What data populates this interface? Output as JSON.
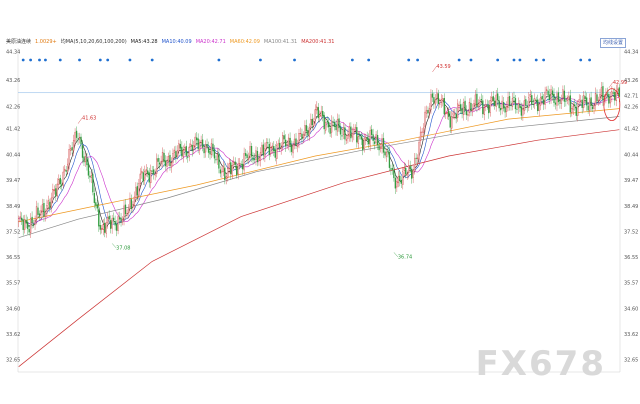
{
  "legend": {
    "instrument": "美原油连续",
    "price": "1.0029+",
    "ma_caption": "均MA(5,10,20,60,100,200)",
    "items": [
      {
        "text": "MA5:43.28",
        "color": "#222222"
      },
      {
        "text": "MA10:40.09",
        "color": "#2255cc"
      },
      {
        "text": "MA20:42.71",
        "color": "#cc33cc"
      },
      {
        "text": "MA60:42.09",
        "color": "#ee9922"
      },
      {
        "text": "MA100:41.31",
        "color": "#888888"
      },
      {
        "text": "MA200:41.31",
        "color": "#cc3333"
      }
    ]
  },
  "toolbar": {
    "settings_button": "均线设置"
  },
  "watermark": "FX678",
  "chart_data": {
    "type": "candlestick",
    "title": "",
    "y_ticks": [
      "44.34",
      "43.26",
      "42.26",
      "41.42",
      "40.44",
      "39.47",
      "38.49",
      "37.52",
      "36.55",
      "35.57",
      "34.60",
      "33.62",
      "32.65"
    ],
    "ylim": [
      32.2,
      44.5
    ],
    "reference_line": 42.8,
    "last_price_label": "42.71",
    "annotations": [
      {
        "text": "41.63",
        "index": 40,
        "value": 41.63,
        "kind": "high"
      },
      {
        "text": "37.08",
        "index": 63,
        "value": 37.08,
        "kind": "low"
      },
      {
        "text": "36.74",
        "index": 253,
        "value": 36.74,
        "kind": "low"
      },
      {
        "text": "43.59",
        "index": 279,
        "value": 43.59,
        "kind": "high"
      },
      {
        "text": "42.99",
        "index": 398,
        "value": 42.99,
        "kind": "high"
      }
    ],
    "segments": [
      {
        "index": 0,
        "value": 37.8
      },
      {
        "index": 10,
        "value": 37.9
      },
      {
        "index": 25,
        "value": 39.0
      },
      {
        "index": 40,
        "value": 41.3
      },
      {
        "index": 48,
        "value": 39.5
      },
      {
        "index": 56,
        "value": 37.6
      },
      {
        "index": 63,
        "value": 37.9
      },
      {
        "index": 72,
        "value": 38.1
      },
      {
        "index": 82,
        "value": 39.5
      },
      {
        "index": 95,
        "value": 40.1
      },
      {
        "index": 110,
        "value": 40.6
      },
      {
        "index": 125,
        "value": 40.9
      },
      {
        "index": 140,
        "value": 39.7
      },
      {
        "index": 150,
        "value": 40.2
      },
      {
        "index": 170,
        "value": 40.7
      },
      {
        "index": 190,
        "value": 41.0
      },
      {
        "index": 200,
        "value": 42.0
      },
      {
        "index": 215,
        "value": 41.4
      },
      {
        "index": 230,
        "value": 41.1
      },
      {
        "index": 245,
        "value": 40.9
      },
      {
        "index": 253,
        "value": 39.5
      },
      {
        "index": 265,
        "value": 39.8
      },
      {
        "index": 279,
        "value": 42.8
      },
      {
        "index": 290,
        "value": 41.9
      },
      {
        "index": 305,
        "value": 42.3
      },
      {
        "index": 320,
        "value": 42.4
      },
      {
        "index": 340,
        "value": 42.3
      },
      {
        "index": 360,
        "value": 42.7
      },
      {
        "index": 375,
        "value": 42.3
      },
      {
        "index": 390,
        "value": 42.5
      },
      {
        "index": 398,
        "value": 42.8
      },
      {
        "index": 405,
        "value": 42.6
      }
    ],
    "ma_lines": [
      {
        "name": "MA60",
        "color": "#ee9922",
        "points": [
          [
            0,
            37.9
          ],
          [
            60,
            38.6
          ],
          [
            120,
            39.3
          ],
          [
            200,
            40.4
          ],
          [
            260,
            41.0
          ],
          [
            330,
            41.8
          ],
          [
            405,
            42.2
          ]
        ]
      },
      {
        "name": "MA100",
        "color": "#888888",
        "points": [
          [
            0,
            37.3
          ],
          [
            40,
            38.0
          ],
          [
            100,
            38.8
          ],
          [
            160,
            39.8
          ],
          [
            230,
            40.6
          ],
          [
            300,
            41.3
          ],
          [
            405,
            41.9
          ]
        ]
      },
      {
        "name": "MA200",
        "color": "#cc3333",
        "points": [
          [
            0,
            32.4
          ],
          [
            40,
            34.2
          ],
          [
            90,
            36.4
          ],
          [
            150,
            38.1
          ],
          [
            220,
            39.4
          ],
          [
            290,
            40.4
          ],
          [
            350,
            41.0
          ],
          [
            405,
            41.4
          ]
        ]
      }
    ],
    "signal_dots": [
      3,
      8,
      14,
      18,
      28,
      41,
      55,
      60,
      75,
      90,
      135,
      163,
      186,
      225,
      236,
      263,
      269,
      297,
      305,
      323,
      334,
      338,
      349,
      354,
      379,
      385
    ]
  }
}
